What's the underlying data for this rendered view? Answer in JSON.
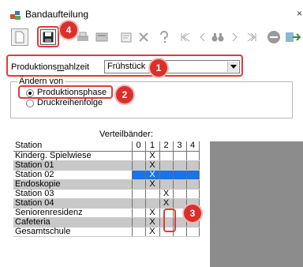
{
  "window": {
    "title": "Bandaufteilung",
    "close_glyph": "×"
  },
  "toolbar": {
    "icons": [
      "new-document-icon",
      "save-icon",
      "print-icon",
      "print-preview-icon",
      "properties-icon",
      "delete-icon",
      "help-icon",
      "first-record-icon",
      "previous-record-icon",
      "search-binoculars-icon",
      "next-record-icon",
      "last-record-icon",
      "stop-icon",
      "exit-icon"
    ]
  },
  "form": {
    "label_prefix": "Produktions",
    "label_accel": "m",
    "label_suffix": "ahlzeit",
    "select_value": "Frühstück"
  },
  "group": {
    "legend": "Ändern von",
    "options": [
      {
        "label": "Produktionsphase",
        "checked": true
      },
      {
        "label": "Druckreihenfolge",
        "checked": false
      }
    ]
  },
  "grid": {
    "caption": "Verteilbänder:",
    "columns": [
      "Station",
      "0",
      "1",
      "2",
      "3",
      "4"
    ],
    "rows": [
      {
        "name": "Kinderg. Spielwiese",
        "marks": [
          "",
          "X",
          "",
          "",
          ""
        ],
        "shade": false,
        "selected": false
      },
      {
        "name": "Station 01",
        "marks": [
          "",
          "X",
          "",
          "",
          ""
        ],
        "shade": true,
        "selected": false
      },
      {
        "name": "Station 02",
        "marks": [
          "",
          "X",
          "",
          "",
          ""
        ],
        "shade": false,
        "selected": true
      },
      {
        "name": "Endoskopie",
        "marks": [
          "",
          "X",
          "",
          "",
          ""
        ],
        "shade": true,
        "selected": false
      },
      {
        "name": "Station 03",
        "marks": [
          "",
          "",
          "X",
          "",
          ""
        ],
        "shade": false,
        "selected": false
      },
      {
        "name": "Station 04",
        "marks": [
          "",
          "",
          "X",
          "",
          ""
        ],
        "shade": true,
        "selected": false
      },
      {
        "name": "Seniorenresidenz",
        "marks": [
          "",
          "X",
          "",
          "",
          ""
        ],
        "shade": false,
        "selected": false
      },
      {
        "name": "Cafeteria",
        "marks": [
          "",
          "X",
          "",
          "",
          ""
        ],
        "shade": true,
        "selected": false
      },
      {
        "name": "Gesamtschule",
        "marks": [
          "",
          "X",
          "",
          "",
          ""
        ],
        "shade": false,
        "selected": false
      }
    ]
  },
  "annotations": [
    "1",
    "2",
    "3",
    "4"
  ],
  "colors": {
    "annotation_red": "#d9302c",
    "selection_blue": "#1a73e8",
    "row_shade": "#c8c8c8"
  }
}
